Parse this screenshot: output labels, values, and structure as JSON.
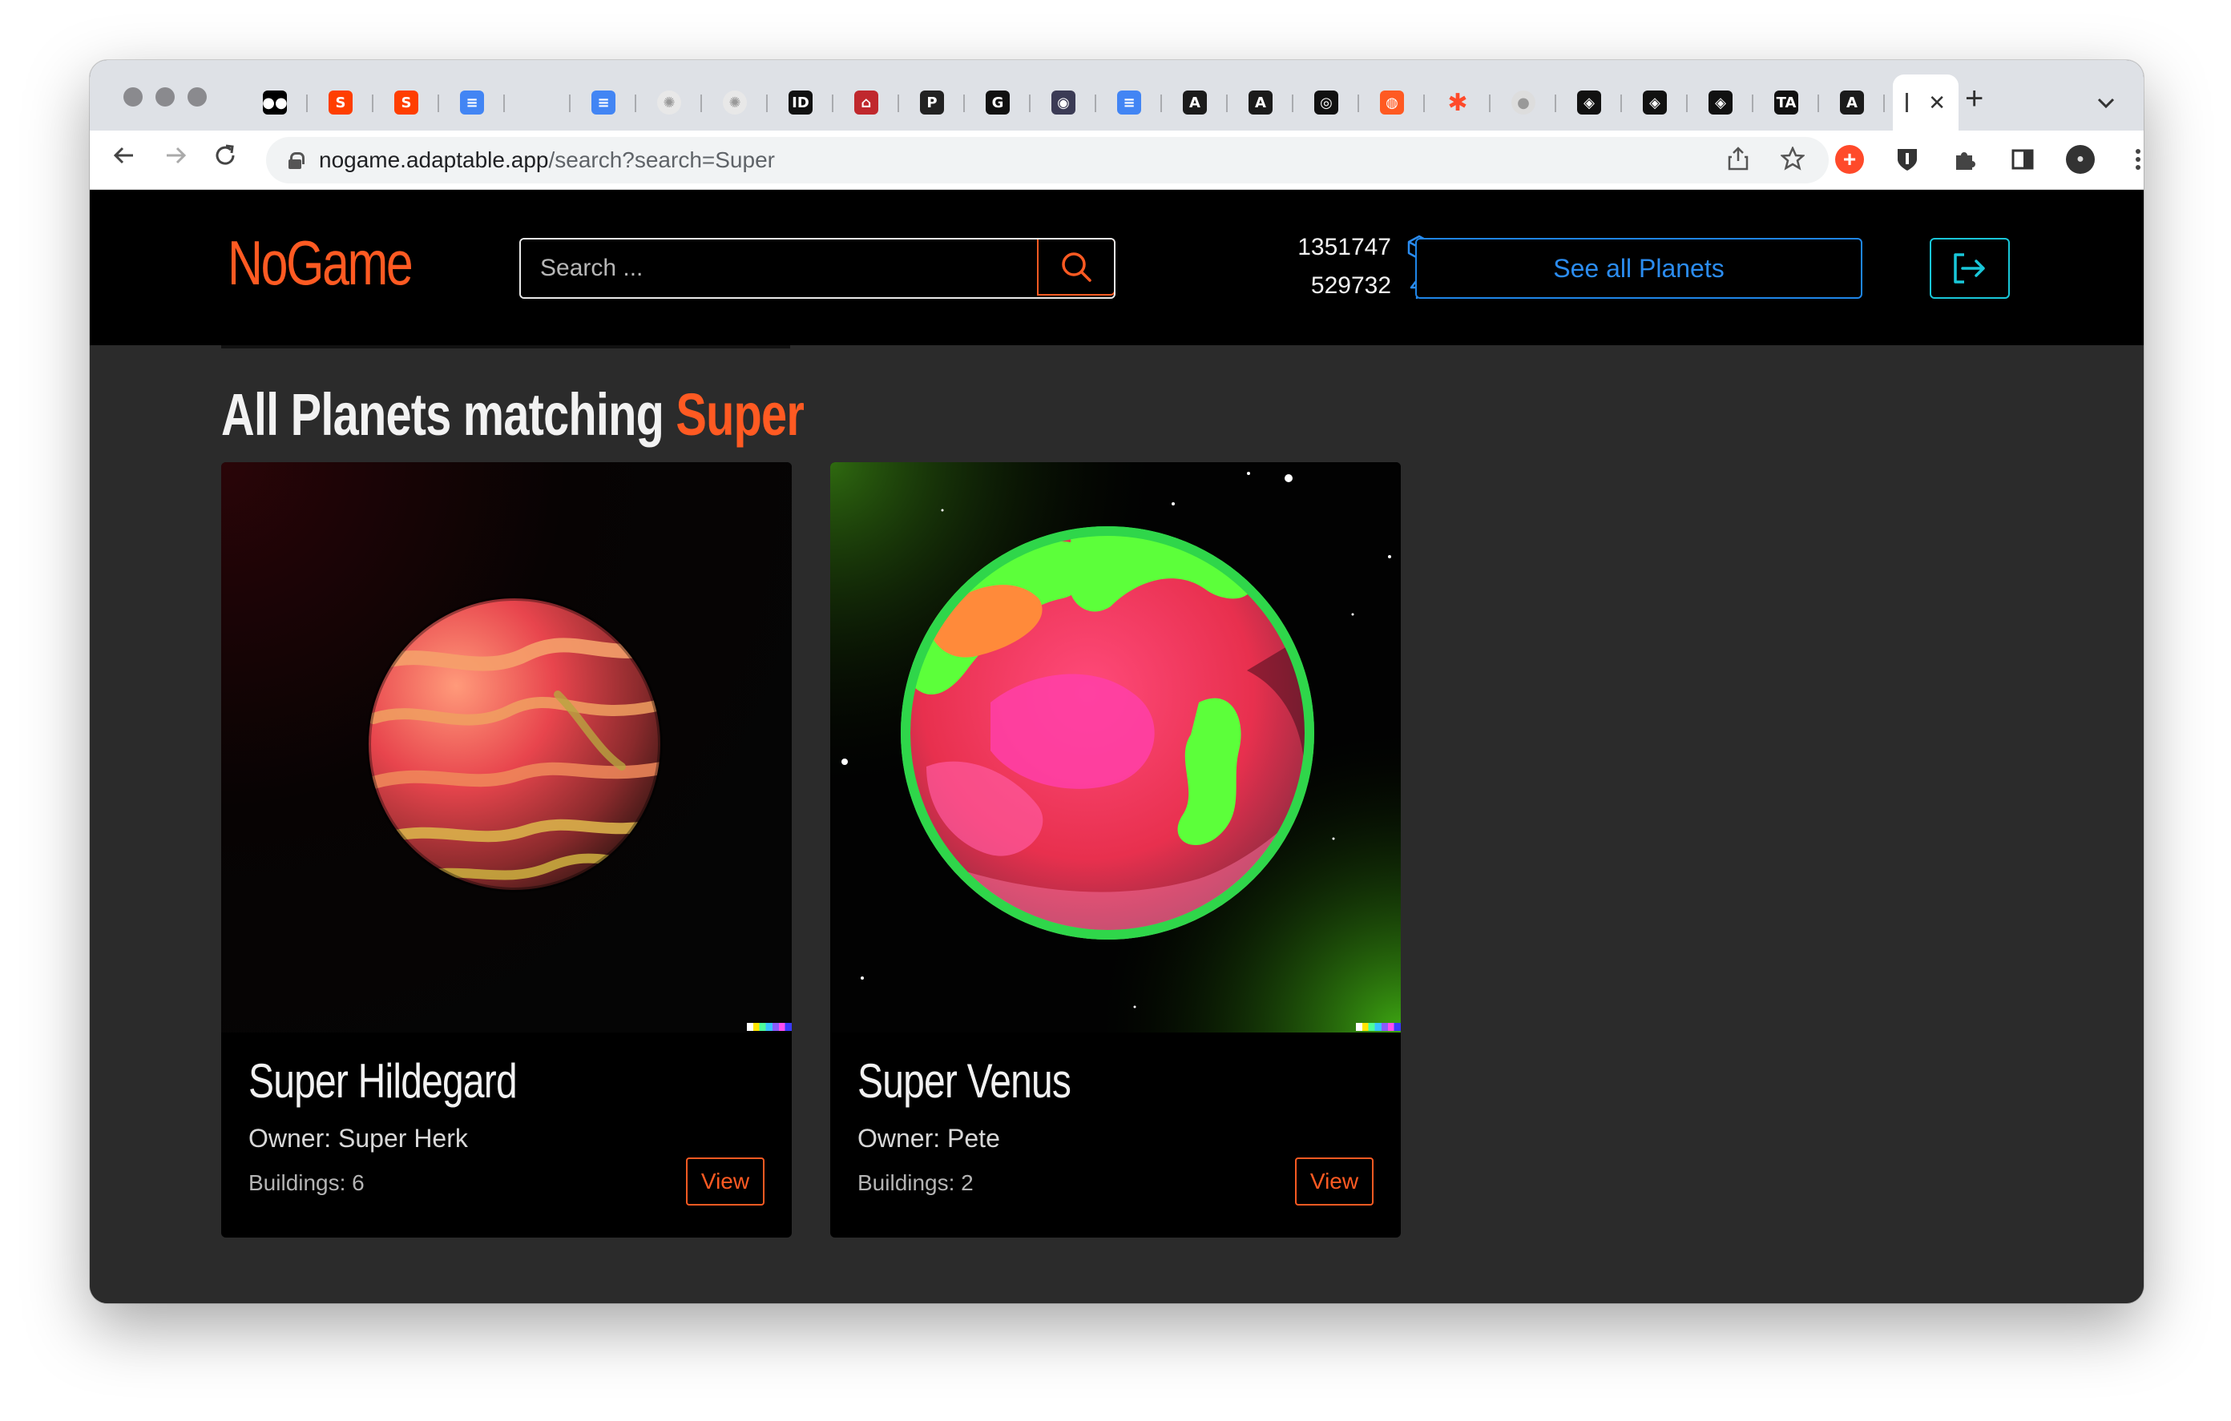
{
  "browser": {
    "url_host": "nogame.adaptable.app",
    "url_path": "/search?search=Super",
    "active_tab_close": "✕",
    "new_tab": "+",
    "tab_menu": "⌄"
  },
  "tabs": [
    {
      "icon": "medium-icon",
      "glyph": "●●",
      "bg": "#000000"
    },
    {
      "icon": "svelte-icon",
      "glyph": "S",
      "bg": "#ff3e00"
    },
    {
      "icon": "svelte-icon",
      "glyph": "S",
      "bg": "#ff3e00"
    },
    {
      "icon": "google-docs-icon",
      "glyph": "≡",
      "bg": "#4285f4"
    },
    {
      "icon": "blank-icon",
      "glyph": "",
      "bg": "transparent"
    },
    {
      "icon": "google-docs-icon",
      "glyph": "≡",
      "bg": "#4285f4"
    },
    {
      "icon": "dots-icon",
      "glyph": "✺",
      "bg": "#e8e8e8"
    },
    {
      "icon": "dots-icon",
      "glyph": "✺",
      "bg": "#e8e8e8"
    },
    {
      "icon": "ideo-icon",
      "glyph": "ID",
      "bg": "#111111"
    },
    {
      "icon": "museum-icon",
      "glyph": "⌂",
      "bg": "#c0282d"
    },
    {
      "icon": "p-icon",
      "glyph": "P",
      "bg": "#222222"
    },
    {
      "icon": "g-icon",
      "glyph": "G",
      "bg": "#111111"
    },
    {
      "icon": "brain-icon",
      "glyph": "◉",
      "bg": "#3b3b55"
    },
    {
      "icon": "google-docs-icon",
      "glyph": "≡",
      "bg": "#4285f4"
    },
    {
      "icon": "astro-icon",
      "glyph": "A",
      "bg": "#1b1b1b"
    },
    {
      "icon": "astro-icon",
      "glyph": "A",
      "bg": "#1b1b1b"
    },
    {
      "icon": "github-icon",
      "glyph": "◎",
      "bg": "#111111"
    },
    {
      "icon": "lifebuoy-icon",
      "glyph": "◍",
      "bg": "#ff5a22"
    },
    {
      "icon": "asterisk-icon",
      "glyph": "✱",
      "bg": "transparent"
    },
    {
      "icon": "sphere-icon",
      "glyph": "●",
      "bg": "#dddddd"
    },
    {
      "icon": "codepen-icon",
      "glyph": "◈",
      "bg": "#111111"
    },
    {
      "icon": "codepen-icon",
      "glyph": "◈",
      "bg": "#111111"
    },
    {
      "icon": "codepen-icon",
      "glyph": "◈",
      "bg": "#111111"
    },
    {
      "icon": "ta-icon",
      "glyph": "TA",
      "bg": "#111111"
    },
    {
      "icon": "astro-icon",
      "glyph": "A",
      "bg": "#1b1b1b"
    }
  ],
  "header": {
    "logo": "NoGame",
    "search_placeholder": "Search ...",
    "stat_resources": "1351747",
    "stat_energy": "529732",
    "see_all": "See all Planets"
  },
  "main": {
    "heading_prefix": "All Planets matching",
    "heading_query": "Super"
  },
  "planets": [
    {
      "name": "Super Hildegard",
      "owner": "Owner: Super Herk",
      "buildings": "Buildings: 6",
      "view": "View"
    },
    {
      "name": "Super Venus",
      "owner": "Owner: Pete",
      "buildings": "Buildings: 2",
      "view": "View"
    }
  ],
  "colors": {
    "accent": "#ff5a22",
    "blue": "#1f86e8",
    "cyan": "#19c7d9",
    "header_bg": "#000000",
    "page_bg": "#2b2b2b"
  }
}
